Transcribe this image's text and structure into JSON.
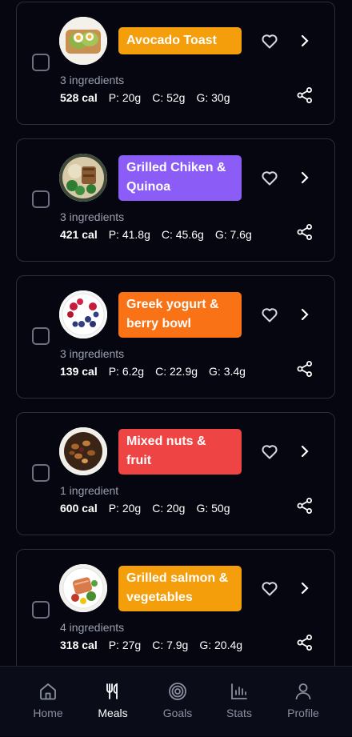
{
  "meals": [
    {
      "name": "Avocado Toast",
      "ingredients": "3 ingredients",
      "cal": "528 cal",
      "p": "P: 20g",
      "c": "C: 52g",
      "g": "G: 30g",
      "color": "#f59e0b",
      "image": "avocado-toast"
    },
    {
      "name": "Grilled Chiken & Quinoa",
      "ingredients": "3 ingredients",
      "cal": "421 cal",
      "p": "P: 41.8g",
      "c": "C: 45.6g",
      "g": "G: 7.6g",
      "color": "#8b5cf6",
      "image": "chicken-quinoa"
    },
    {
      "name": "Greek yogurt & berry bowl",
      "ingredients": "3 ingredients",
      "cal": "139 cal",
      "p": "P: 6.2g",
      "c": "C: 22.9g",
      "g": "G: 3.4g",
      "color": "#f97316",
      "image": "yogurt-berries"
    },
    {
      "name": "Mixed nuts & fruit",
      "ingredients": "1 ingredient",
      "cal": "600 cal",
      "p": "P: 20g",
      "c": "C: 20g",
      "g": "G: 50g",
      "color": "#ef4444",
      "image": "mixed-nuts"
    },
    {
      "name": "Grilled salmon & vegetables",
      "ingredients": "4 ingredients",
      "cal": "318 cal",
      "p": "P: 27g",
      "c": "C: 7.9g",
      "g": "G: 20.4g",
      "color": "#f59e0b",
      "image": "salmon-vegetables"
    }
  ],
  "nav": {
    "home": "Home",
    "meals": "Meals",
    "goals": "Goals",
    "stats": "Stats",
    "profile": "Profile",
    "active": "meals"
  },
  "icons": {
    "favorite": "heart-icon",
    "open": "chevron-right-icon",
    "share": "share-icon"
  }
}
